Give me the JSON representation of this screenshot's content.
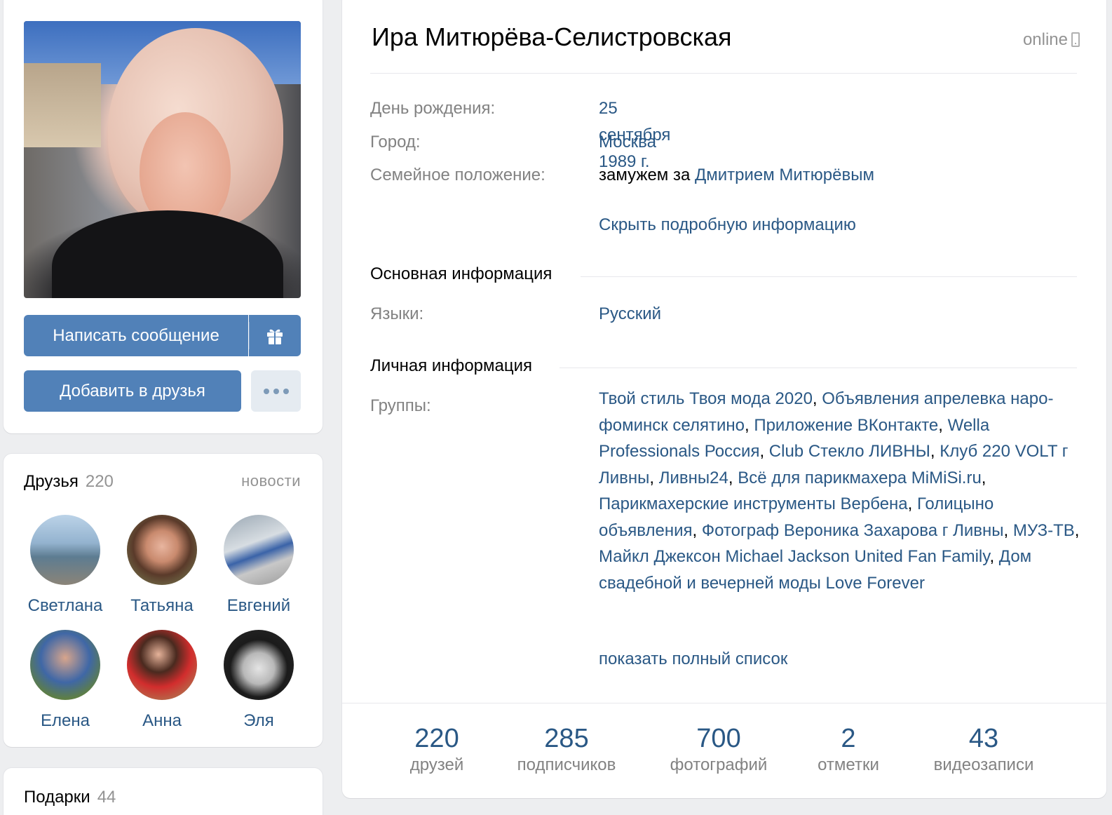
{
  "profile": {
    "name": "Ира Митюрёва-Селистровская",
    "status": "online",
    "buttons": {
      "message": "Написать сообщение",
      "add_friend": "Добавить в друзья"
    },
    "info": {
      "birthday_label": "День рождения:",
      "birthday_value": "25 сентября 1989 г.",
      "city_label": "Город:",
      "city_value": "Москва",
      "relationship_label": "Семейное положение:",
      "relationship_prefix": "замужем за",
      "relationship_partner": "Дмитрием Митюрёвым",
      "hide_details": "Скрыть подробную информацию"
    },
    "basic": {
      "title": "Основная информация",
      "languages_label": "Языки:",
      "languages_value": "Русский"
    },
    "personal": {
      "title": "Личная информация",
      "groups_label": "Группы:",
      "groups": [
        "Твой стиль Твоя мода 2020",
        "Объявления апрелевка наро-фоминск селятино",
        "Приложение ВКонтакте",
        "Wella Professionals Россия",
        "Club Стекло ЛИВНЫ",
        "Клуб 220 VOLT г Ливны",
        "Ливны24",
        "Всё для парикмахера MiMiSi.ru",
        "Парикмахерские инструменты Вербена",
        "Голицыно объявления",
        "Фотограф Вероника Захарова г Ливны",
        "МУЗ-ТВ",
        "Майкл Джексон Michael Jackson United Fan Family",
        "Дом свадебной и вечерней моды Love Forever"
      ],
      "show_full_list": "показать полный список"
    },
    "stats": [
      {
        "value": "220",
        "label": "друзей"
      },
      {
        "value": "285",
        "label": "подписчиков"
      },
      {
        "value": "700",
        "label": "фотографий"
      },
      {
        "value": "2",
        "label": "отметки"
      },
      {
        "value": "43",
        "label": "видеозаписи"
      }
    ]
  },
  "friends": {
    "title": "Друзья",
    "count": "220",
    "news_link": "новости",
    "items": [
      {
        "name": "Светлана"
      },
      {
        "name": "Татьяна"
      },
      {
        "name": "Евгений"
      },
      {
        "name": "Елена"
      },
      {
        "name": "Анна"
      },
      {
        "name": "Эля"
      }
    ]
  },
  "gifts": {
    "title": "Подарки",
    "count": "44"
  },
  "icons": {
    "gift": "gift-icon",
    "more": "more-dots-icon",
    "phone": "mobile-phone-icon"
  },
  "colors": {
    "accent": "#5181b8",
    "link": "#2a5885",
    "muted": "#828282",
    "background": "#edeef0"
  }
}
